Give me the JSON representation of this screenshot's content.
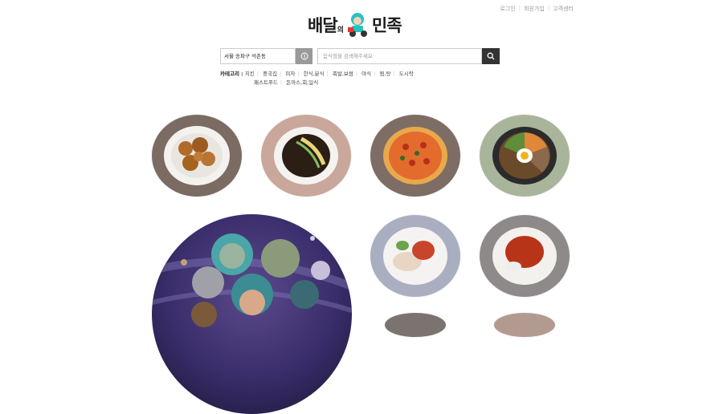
{
  "top_links": [
    "로그인",
    "회원가입",
    "고객센터"
  ],
  "logo": {
    "part1": "배달",
    "mid": "의",
    "part2": "민족"
  },
  "address": {
    "value": "서울 송파구 석촌동"
  },
  "search": {
    "placeholder": "음식점을 검색해주세요"
  },
  "categories": {
    "title": "카테고리 :",
    "items": [
      "치킨",
      "중국집",
      "피자",
      "한식,분식",
      "족발,보쌈",
      "야식",
      "찜,탕",
      "도시락",
      "패스트푸드",
      "돈까스,회,일식"
    ],
    "row2": [
      "",
      "",
      ""
    ]
  },
  "food_plates": [
    {
      "name": "chicken",
      "rim": "#7b6b62"
    },
    {
      "name": "jajangmyeon",
      "rim": "#c9a79a"
    },
    {
      "name": "pizza",
      "rim": "#7d6d65"
    },
    {
      "name": "bibimbap",
      "rim": "#a9b59b"
    },
    {
      "name": "bossam",
      "rim": "#a9afc0"
    },
    {
      "name": "tteokbokki",
      "rim": "#8e8a89"
    }
  ],
  "colors": {
    "accent": "#2ac1bc",
    "dark": "#333333"
  }
}
